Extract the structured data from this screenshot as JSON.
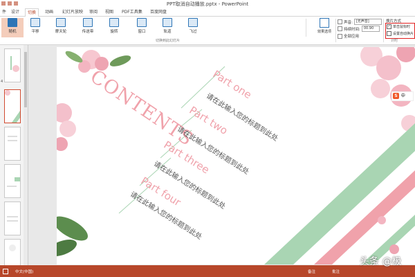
{
  "window": {
    "title": "PPT取消自动播放.pptx - PowerPoint"
  },
  "tabs": [
    "件",
    "设计",
    "切换",
    "动画",
    "幻灯片放映",
    "审阅",
    "视图",
    "PDF工具集",
    "百度网盘"
  ],
  "active_tab": "切换",
  "ribbon": {
    "transitions": [
      "随机",
      "平移",
      "摩天轮",
      "传送带",
      "旋转",
      "窗口",
      "轨道",
      "飞过"
    ],
    "selected_transition": "随机",
    "effect_options": "效果选项",
    "group_label": "切换到此幻灯片",
    "timing": {
      "sound_label": "声音:",
      "sound_value": "[无声音]",
      "duration_label": "持续时间:",
      "duration_value": "00.90",
      "apply_all": "全部应用",
      "group_label": "计时"
    },
    "advance": {
      "title": "换片方式",
      "on_click": "单击鼠标时",
      "on_click_checked": true,
      "auto_after": "设置自动换片",
      "auto_checked": false
    }
  },
  "slide": {
    "contents_title": "CONTENTS",
    "parts": [
      {
        "title": "Part one",
        "subtitle": "请在此输入您的标题到此处"
      },
      {
        "title": "Part two",
        "subtitle": "请在此输入您的标题到此处"
      },
      {
        "title": "Part three",
        "subtitle": "请在此输入您的标题到此处"
      },
      {
        "title": "Part four",
        "subtitle": "请在此输入您的标题到此处"
      }
    ]
  },
  "sogou": {
    "logo": "S",
    "mode": "中"
  },
  "statusbar": {
    "language": "中文(中国)",
    "notes": "备注",
    "comments": "批注"
  },
  "watermark": "头条 @极",
  "colors": {
    "accent": "#b7472a",
    "pink": "#f0a2ab",
    "green": "#a9d5b3"
  }
}
